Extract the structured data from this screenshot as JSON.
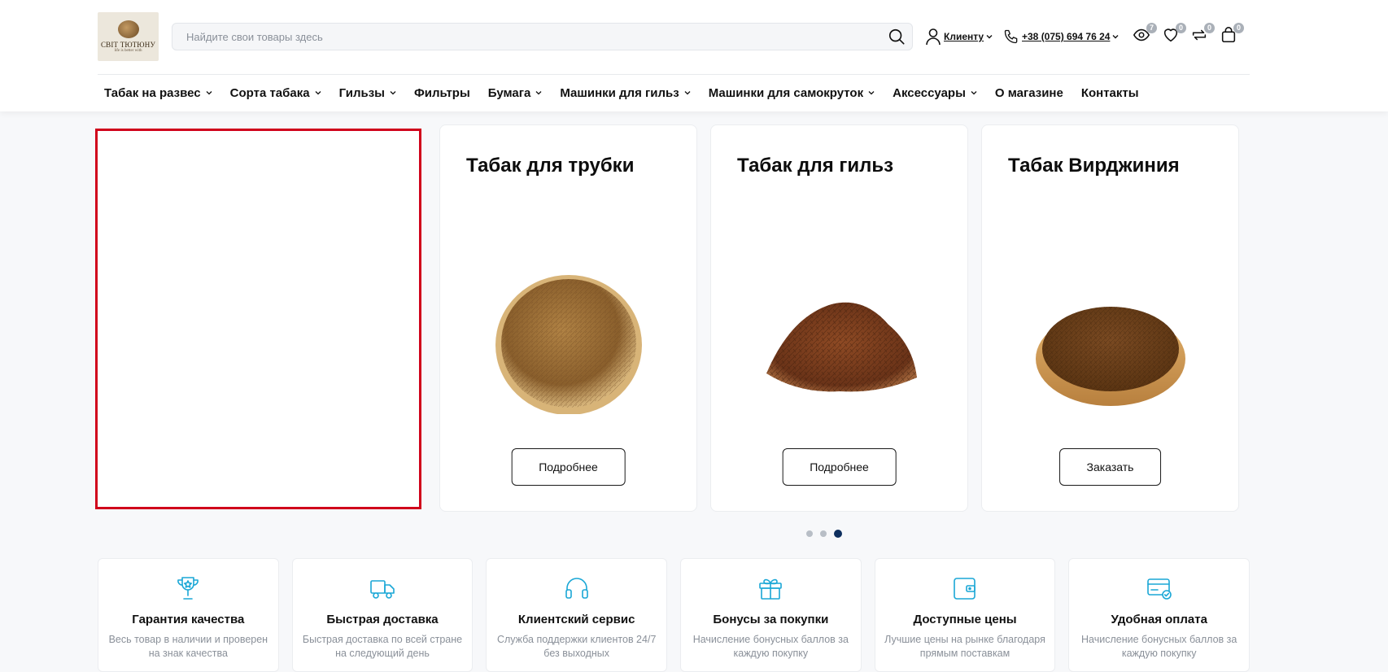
{
  "header": {
    "logo": {
      "line1": "СВІТ ТЮТЮНУ",
      "line2": "life is better with"
    },
    "search": {
      "placeholder": "Найдите свои товары здесь"
    },
    "account": {
      "label": "Клиенту"
    },
    "phone": {
      "label": "+38 (075) 694 76 24"
    },
    "badges": {
      "viewed": "7",
      "wishlist": "0",
      "compare": "0",
      "cart": "0"
    }
  },
  "nav": {
    "items": [
      {
        "label": "Табак на развес",
        "dropdown": true
      },
      {
        "label": "Сорта табака",
        "dropdown": true
      },
      {
        "label": "Гильзы",
        "dropdown": true
      },
      {
        "label": "Фильтры",
        "dropdown": false
      },
      {
        "label": "Бумага",
        "dropdown": true
      },
      {
        "label": "Машинки для гильз",
        "dropdown": true
      },
      {
        "label": "Машинки для самокруток",
        "dropdown": true
      },
      {
        "label": "Аксессуары",
        "dropdown": true
      },
      {
        "label": "О магазине",
        "dropdown": false
      },
      {
        "label": "Контакты",
        "dropdown": false
      }
    ]
  },
  "slider": {
    "cards": [
      {
        "title": "Табак для трубки",
        "button": "Подробнее",
        "image": "pipe-tobacco-bowl"
      },
      {
        "title": "Табак для гильз",
        "button": "Подробнее",
        "image": "loose-tobacco-pile"
      },
      {
        "title": "Табак Вирджиния",
        "button": "Заказать",
        "image": "virginia-tobacco-bowl"
      }
    ],
    "dots": 3,
    "active_dot": 3
  },
  "features": [
    {
      "icon": "trophy-icon",
      "title": "Гарантия качества",
      "desc": "Весь товар в наличии и проверен на знак качества"
    },
    {
      "icon": "truck-icon",
      "title": "Быстрая доставка",
      "desc": "Быстрая доставка по всей стране на следующий день"
    },
    {
      "icon": "headphones-icon",
      "title": "Клиентский сервис",
      "desc": "Служба поддержки клиентов 24/7 без выходных"
    },
    {
      "icon": "gift-icon",
      "title": "Бонусы за покупки",
      "desc": "Начисление бонусных баллов за каждую покупку"
    },
    {
      "icon": "wallet-icon",
      "title": "Доступные цены",
      "desc": "Лучшие цены на рынке благодаря прямым поставкам"
    },
    {
      "icon": "card-check-icon",
      "title": "Удобная оплата",
      "desc": "Начисление бонусных баллов за каждую покупку"
    }
  ],
  "colors": {
    "accent": "#1aa7d6",
    "highlight_border": "#d0021b",
    "dot_active": "#0e2f5e"
  }
}
